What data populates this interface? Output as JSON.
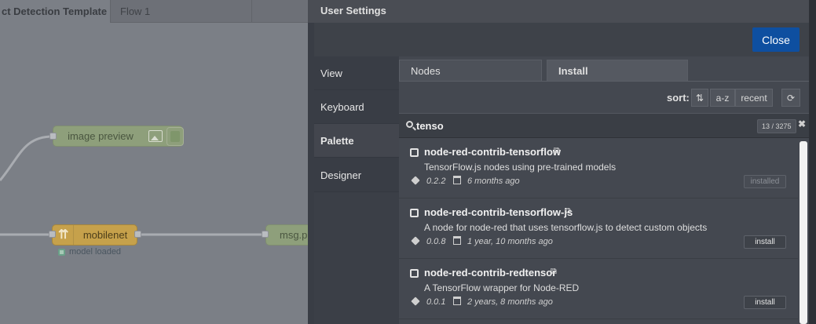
{
  "editor": {
    "tabs": [
      {
        "label": "ct Detection Template"
      },
      {
        "label": "Flow 1"
      }
    ],
    "nodes": {
      "image_preview": {
        "label": "image preview"
      },
      "mobilenet": {
        "label": "mobilenet",
        "icon": "tensorflow-icon",
        "status": "model loaded"
      },
      "msg": {
        "label": "msg.p"
      }
    }
  },
  "settings": {
    "title": "User Settings",
    "close_label": "Close",
    "nav": [
      {
        "label": "View"
      },
      {
        "label": "Keyboard"
      },
      {
        "label": "Palette",
        "active": true
      },
      {
        "label": "Designer"
      }
    ],
    "palette": {
      "tabs": [
        {
          "label": "Nodes"
        },
        {
          "label": "Install",
          "active": true
        }
      ],
      "sort": {
        "label": "sort:",
        "options": [
          "a-z",
          "recent"
        ]
      },
      "search": {
        "value": "tenso",
        "count": "13 / 3275",
        "clear": "✖"
      },
      "results": [
        {
          "name": "node-red-contrib-tensorflow",
          "description": "TensorFlow.js nodes using pre-trained models",
          "version": "0.2.2",
          "updated": "6 months ago",
          "action": "installed"
        },
        {
          "name": "node-red-contrib-tensorflow-js",
          "description": "A node for node-red that uses tensorflow.js to detect custom objects",
          "version": "0.0.8",
          "updated": "1 year, 10 months ago",
          "action": "install"
        },
        {
          "name": "node-red-contrib-redtensor",
          "description": "A TensorFlow wrapper for Node-RED",
          "version": "0.0.1",
          "updated": "2 years, 8 months ago",
          "action": "install"
        }
      ]
    }
  },
  "colors": {
    "close_button": "#0e4fa0",
    "function_node": "#c6a14b",
    "output_node": "#8e9f7b"
  }
}
